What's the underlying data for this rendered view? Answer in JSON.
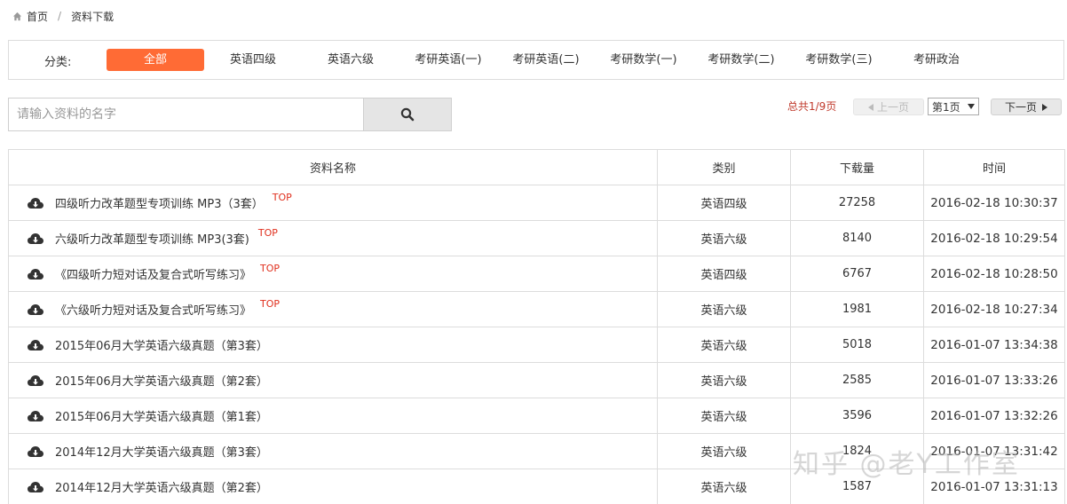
{
  "breadcrumb": {
    "home": "首页",
    "separator": "/",
    "current": "资料下载"
  },
  "categories": {
    "label": "分类:",
    "items": [
      {
        "label": "全部",
        "active": true
      },
      {
        "label": "英语四级",
        "active": false
      },
      {
        "label": "英语六级",
        "active": false
      },
      {
        "label": "考研英语(一)",
        "active": false
      },
      {
        "label": "考研英语(二)",
        "active": false
      },
      {
        "label": "考研数学(一)",
        "active": false
      },
      {
        "label": "考研数学(二)",
        "active": false
      },
      {
        "label": "考研数学(三)",
        "active": false
      },
      {
        "label": "考研政治",
        "active": false
      }
    ],
    "active_color": "#ff6b35"
  },
  "search": {
    "placeholder": "请输入资料的名字",
    "value": ""
  },
  "pager": {
    "info": "总共1/9页",
    "prev": "上一页",
    "page": "第1页",
    "next": "下一页"
  },
  "table": {
    "headers": [
      "资料名称",
      "类别",
      "下载量",
      "时间"
    ],
    "top_tag": "TOP",
    "rows": [
      {
        "name": "四级听力改革题型专项训练 MP3（3套）",
        "top": true,
        "category": "英语四级",
        "downloads": "27258",
        "time": "2016-02-18 10:30:37"
      },
      {
        "name": "六级听力改革题型专项训练 MP3(3套)",
        "top": true,
        "category": "英语六级",
        "downloads": "8140",
        "time": "2016-02-18 10:29:54"
      },
      {
        "name": "《四级听力短对话及复合式听写练习》",
        "top": true,
        "category": "英语四级",
        "downloads": "6767",
        "time": "2016-02-18 10:28:50"
      },
      {
        "name": "《六级听力短对话及复合式听写练习》",
        "top": true,
        "category": "英语六级",
        "downloads": "1981",
        "time": "2016-02-18 10:27:34"
      },
      {
        "name": "2015年06月大学英语六级真题（第3套）",
        "top": false,
        "category": "英语六级",
        "downloads": "5018",
        "time": "2016-01-07 13:34:38"
      },
      {
        "name": "2015年06月大学英语六级真题（第2套）",
        "top": false,
        "category": "英语六级",
        "downloads": "2585",
        "time": "2016-01-07 13:33:26"
      },
      {
        "name": "2015年06月大学英语六级真题（第1套）",
        "top": false,
        "category": "英语六级",
        "downloads": "3596",
        "time": "2016-01-07 13:32:26"
      },
      {
        "name": "2014年12月大学英语六级真题（第3套）",
        "top": false,
        "category": "英语六级",
        "downloads": "1824",
        "time": "2016-01-07 13:31:42"
      },
      {
        "name": "2014年12月大学英语六级真题（第2套）",
        "top": false,
        "category": "英语六级",
        "downloads": "1587",
        "time": "2016-01-07 13:31:13"
      }
    ]
  },
  "watermark": "知乎 @老Y工作室"
}
